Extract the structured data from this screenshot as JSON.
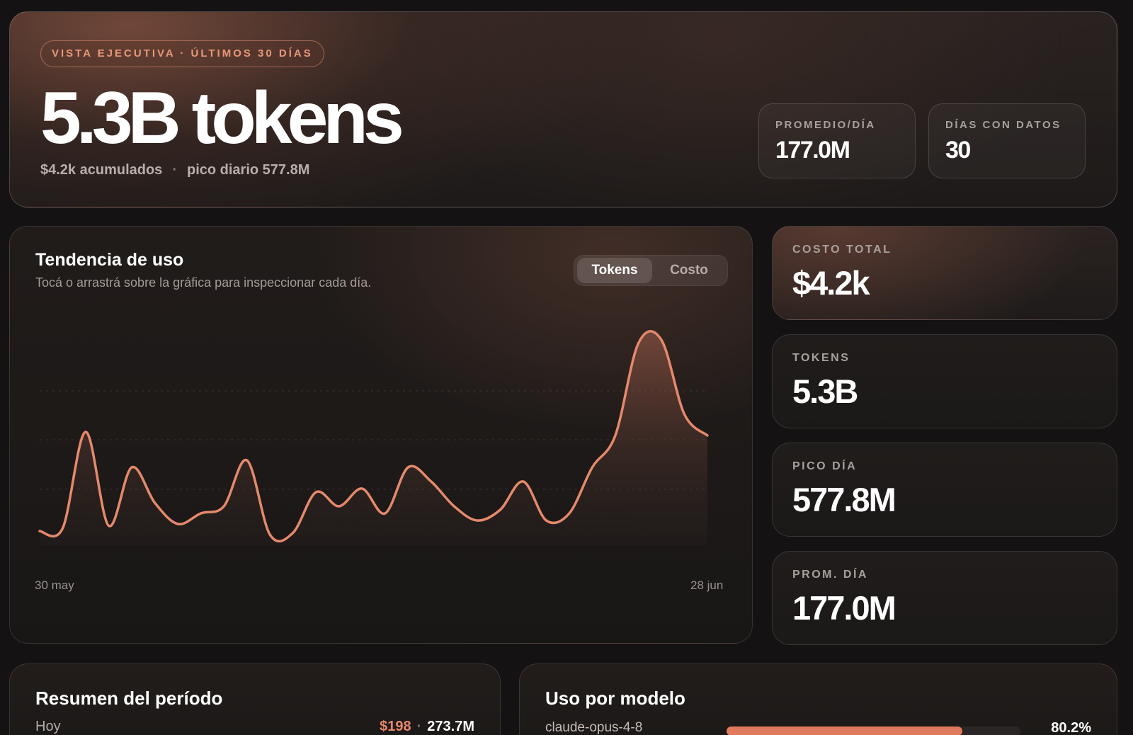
{
  "hero": {
    "badge": "VISTA EJECUTIVA · ÚLTIMOS 30 DÍAS",
    "value": "5.3B tokens",
    "accumulated": "$4.2k acumulados",
    "separator": "·",
    "peak": "pico diario 577.8M",
    "mini": [
      {
        "label": "PROMEDIO/DÍA",
        "value": "177.0M"
      },
      {
        "label": "DÍAS CON DATOS",
        "value": "30"
      }
    ]
  },
  "trend": {
    "title": "Tendencia de uso",
    "subtitle": "Tocá o arrastrá sobre la gráfica para inspeccionar cada día.",
    "toggle": {
      "active": "Tokens",
      "inactive": "Costo"
    },
    "x_start_label": "30 may",
    "x_end_label": "28 jun"
  },
  "stats": [
    {
      "label": "COSTO TOTAL",
      "value": "$4.2k"
    },
    {
      "label": "TOKENS",
      "value": "5.3B"
    },
    {
      "label": "PICO DÍA",
      "value": "577.8M"
    },
    {
      "label": "PROM. DÍA",
      "value": "177.0M"
    }
  ],
  "summary": {
    "title": "Resumen del período",
    "row_label": "Hoy",
    "row_cost": "$198",
    "row_sep": "·",
    "row_tokens": "273.7M"
  },
  "models": {
    "title": "Uso por modelo",
    "items": [
      {
        "name": "claude-opus-4-8",
        "pct_label": "80.2%",
        "pct": 80.2
      }
    ]
  },
  "colors": {
    "accent": "#e8876a",
    "line": "#e5896c"
  },
  "chart_data": {
    "type": "area",
    "x": [
      "30 may",
      "31 may",
      "1 jun",
      "2 jun",
      "3 jun",
      "4 jun",
      "5 jun",
      "6 jun",
      "7 jun",
      "8 jun",
      "9 jun",
      "10 jun",
      "11 jun",
      "12 jun",
      "13 jun",
      "14 jun",
      "15 jun",
      "16 jun",
      "17 jun",
      "18 jun",
      "19 jun",
      "20 jun",
      "21 jun",
      "22 jun",
      "23 jun",
      "24 jun",
      "25 jun",
      "26 jun",
      "27 jun",
      "28 jun"
    ],
    "series": [
      {
        "values": [
          30,
          38,
          310,
          45,
          210,
          110,
          50,
          80,
          100,
          230,
          20,
          25,
          140,
          100,
          150,
          80,
          210,
          170,
          100,
          60,
          90,
          170,
          60,
          80,
          210,
          300,
          560,
          570,
          360,
          300
        ]
      }
    ],
    "grid": true,
    "legend": "none"
  }
}
